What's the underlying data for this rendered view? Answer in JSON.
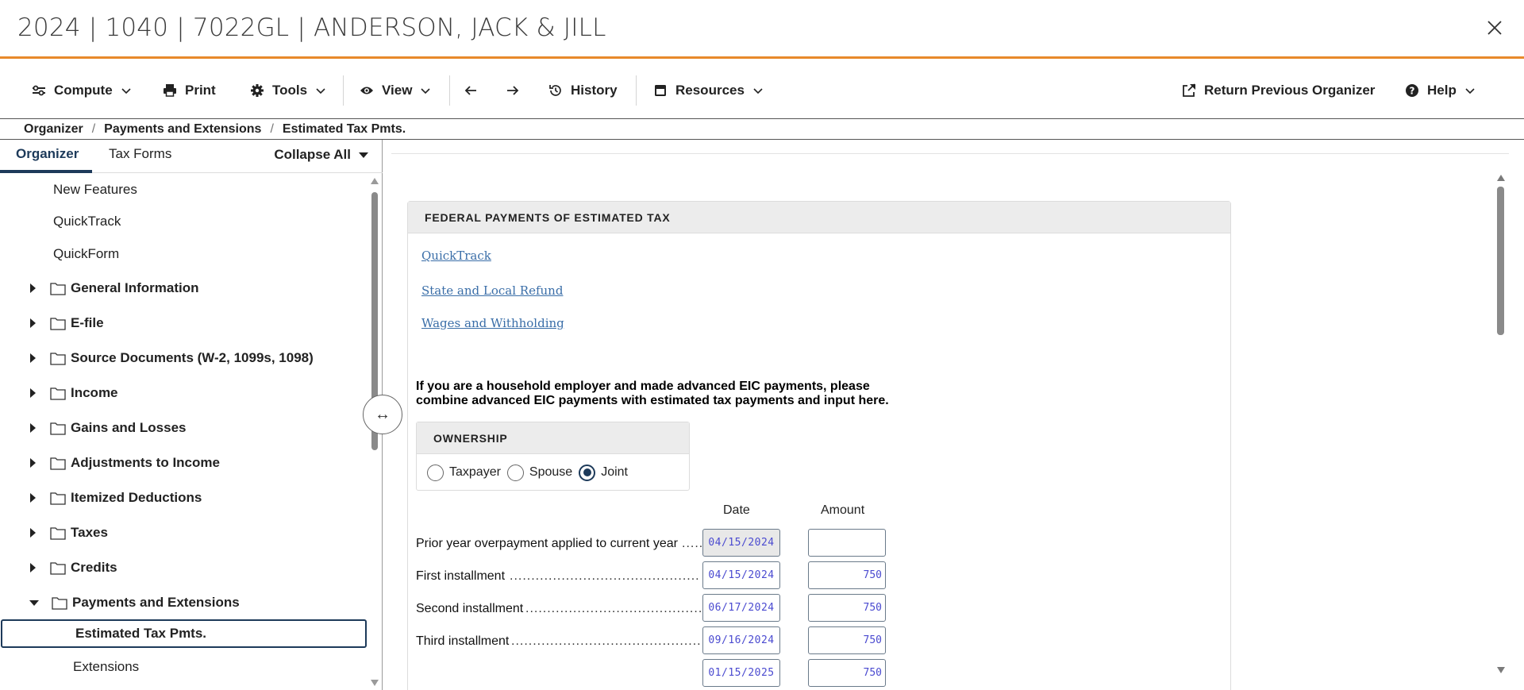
{
  "window": {
    "title": "2024 | 1040 | 7022GL | ANDERSON, JACK & JILL"
  },
  "toolbar": {
    "compute": "Compute",
    "print": "Print",
    "tools": "Tools",
    "view": "View",
    "history": "History",
    "resources": "Resources",
    "return_previous_organizer": "Return Previous Organizer",
    "help": "Help"
  },
  "breadcrumb": [
    "Organizer",
    "Payments and Extensions",
    "Estimated Tax Pmts."
  ],
  "left_panel": {
    "tabs": [
      "Organizer",
      "Tax Forms"
    ],
    "collapse_all": "Collapse All",
    "items": [
      "New Features",
      "QuickTrack",
      "QuickForm",
      "General Information",
      "E-file",
      "Source Documents (W-2, 1099s, 1098)",
      "Income",
      "Gains and Losses",
      "Adjustments to Income",
      "Itemized Deductions",
      "Taxes",
      "Credits",
      "Payments and Extensions",
      "Estimated Tax Pmts.",
      "Extensions"
    ]
  },
  "form": {
    "section_title": "FEDERAL PAYMENTS OF ESTIMATED TAX",
    "links": [
      "QuickTrack",
      "State and Local Refund",
      "Wages and Withholding"
    ],
    "note_line1": "If you are a household employer and made advanced EIC payments, please",
    "note_line2": "combine advanced EIC payments with estimated tax payments and input here.",
    "ownership": {
      "title": "OWNERSHIP",
      "options": [
        "Taxpayer",
        "Spouse",
        "Joint"
      ],
      "selected": "Joint"
    },
    "columns": {
      "date": "Date",
      "amount": "Amount"
    },
    "rows": [
      {
        "label": "Prior year overpayment applied to current year",
        "dots": ".....",
        "date": "04/15/2024",
        "amount": ""
      },
      {
        "label": "First installment",
        "dots": "...........................................................",
        "date": "04/15/2024",
        "amount": "750"
      },
      {
        "label": "Second installment",
        "dots": "...................................................",
        "date": "06/17/2024",
        "amount": "750"
      },
      {
        "label": "Third installment",
        "dots": ".........................................................",
        "date": "09/16/2024",
        "amount": "750"
      },
      {
        "label": "",
        "dots": "",
        "date": "01/15/2025",
        "amount": "750"
      }
    ]
  },
  "colors": {
    "accent_orange": "#e8892b",
    "navy": "#1d3a5a",
    "link_blue": "#3a6ea8",
    "input_text": "#4a4ad0"
  }
}
